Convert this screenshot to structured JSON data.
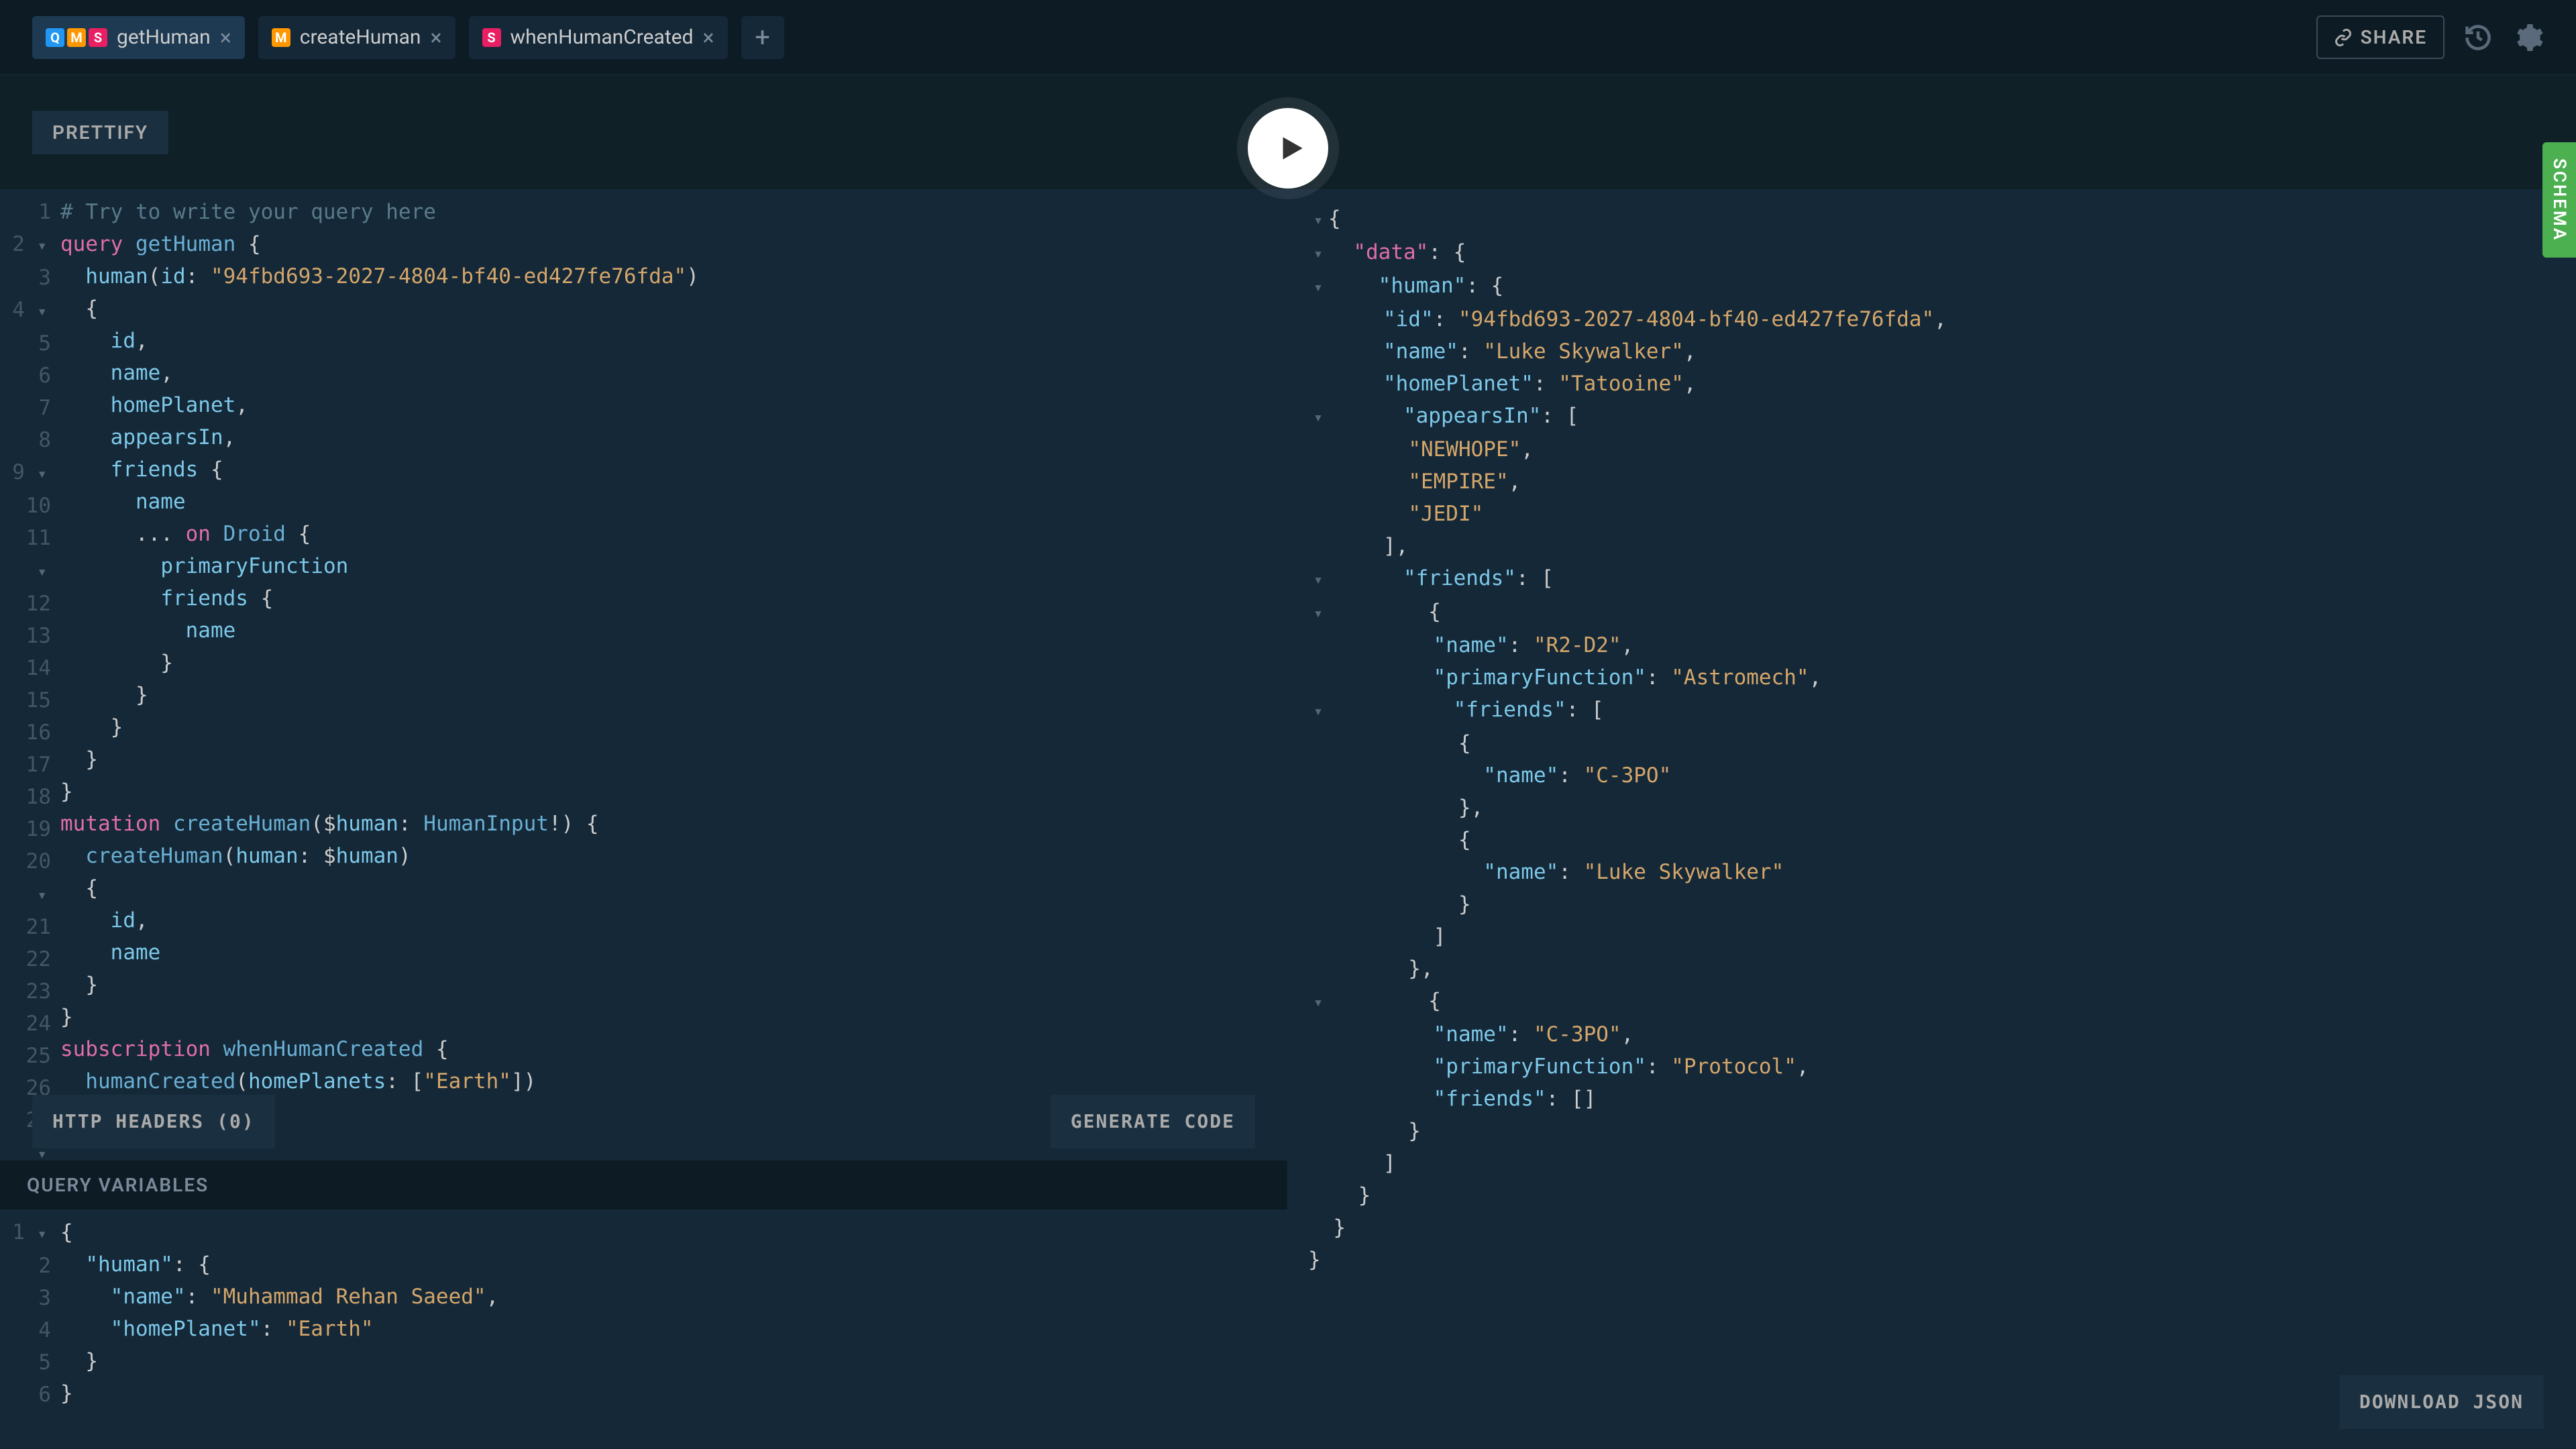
{
  "tabs": [
    {
      "label": "getHuman",
      "badges": [
        "Q",
        "M",
        "S"
      ],
      "active": true
    },
    {
      "label": "createHuman",
      "badges": [
        "M"
      ],
      "active": false
    },
    {
      "label": "whenHumanCreated",
      "badges": [
        "S"
      ],
      "active": false
    }
  ],
  "toolbar": {
    "share": "SHARE",
    "prettify": "PRETTIFY",
    "http_headers": "HTTP HEADERS (0)",
    "generate_code": "GENERATE CODE",
    "query_variables": "QUERY VARIABLES",
    "download_json": "DOWNLOAD JSON",
    "schema": "SCHEMA"
  },
  "query": {
    "lines": [
      "# Try to write your query here",
      "query getHuman {",
      "  human(id: \"94fbd693-2027-4804-bf40-ed427fe76fda\")",
      "  {",
      "    id,",
      "    name,",
      "    homePlanet,",
      "    appearsIn,",
      "    friends {",
      "      name",
      "      ... on Droid {",
      "        primaryFunction",
      "        friends {",
      "          name",
      "        }",
      "      }",
      "    }",
      "  }",
      "}",
      "mutation createHuman($human: HumanInput!) {",
      "  createHuman(human: $human)",
      "  {",
      "    id,",
      "    name",
      "  }",
      "}",
      "subscription whenHumanCreated {",
      "  humanCreated(homePlanets: [\"Earth\"])",
      "  {"
    ]
  },
  "variables": {
    "lines": [
      "{",
      "  \"human\": {",
      "    \"name\": \"Muhammad Rehan Saeed\",",
      "    \"homePlanet\": \"Earth\"",
      "  }",
      "}"
    ]
  },
  "result": {
    "data": {
      "human": {
        "id": "94fbd693-2027-4804-bf40-ed427fe76fda",
        "name": "Luke Skywalker",
        "homePlanet": "Tatooine",
        "appearsIn": [
          "NEWHOPE",
          "EMPIRE",
          "JEDI"
        ],
        "friends": [
          {
            "name": "R2-D2",
            "primaryFunction": "Astromech",
            "friends": [
              {
                "name": "C-3PO"
              },
              {
                "name": "Luke Skywalker"
              }
            ]
          },
          {
            "name": "C-3PO",
            "primaryFunction": "Protocol",
            "friends": []
          }
        ]
      }
    }
  }
}
